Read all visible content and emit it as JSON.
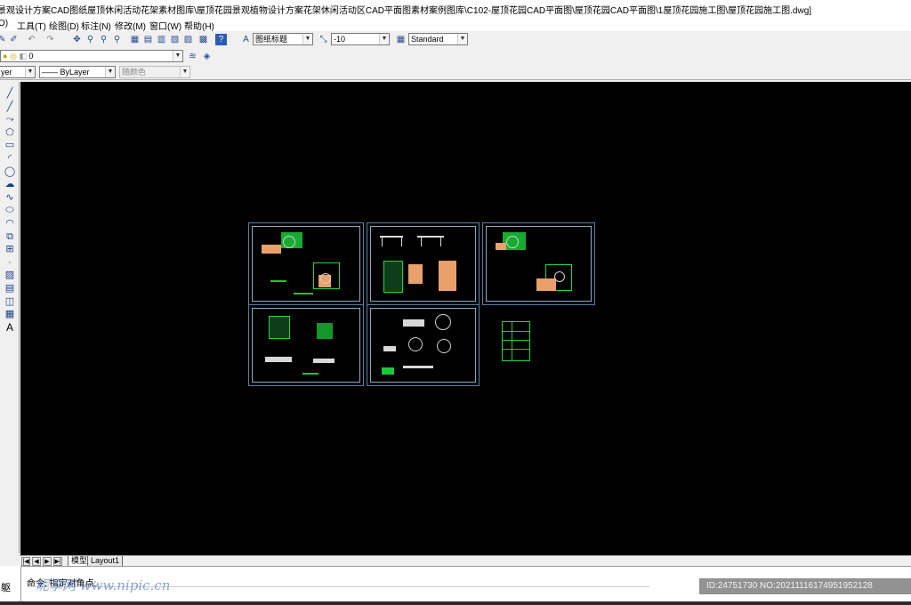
{
  "window": {
    "title": "景观设计方案CAD图纸屋顶休闲活动花架素材图库\\屋顶花园景观植物设计方案花架休闲活动区CAD平面图素材案例图库\\C102-屋顶花园CAD平面图\\屋顶花园CAD平面图\\1屋顶花园施工图\\屋顶花园施工图.dwg]"
  },
  "menu": [
    {
      "label": "O)"
    },
    {
      "label": "工具(T)"
    },
    {
      "label": "绘图(D)"
    },
    {
      "label": "标注(N)"
    },
    {
      "label": "修改(M)"
    },
    {
      "label": "窗口(W)"
    },
    {
      "label": "帮助(H)"
    }
  ],
  "toolbar": {
    "text_style": "图纸标题",
    "dim_value": "-10",
    "table_style": "Standard",
    "layer": "0",
    "layer_partial": "yer",
    "linetype": "ByLayer",
    "color": "随颜色"
  },
  "draw_tools": [
    "line-icon",
    "ray-icon",
    "polyline-icon",
    "polygon-icon",
    "rectangle-icon",
    "arc-icon",
    "circle-icon",
    "cloud-icon",
    "spline-icon",
    "ellipse-icon",
    "ellipse-arc-icon",
    "insert-block-icon",
    "make-block-icon",
    "point-icon",
    "hatch-icon",
    "gradient-icon",
    "region-icon",
    "table-icon",
    "mtext-icon"
  ],
  "tabs": [
    {
      "label": "模型",
      "active": true
    },
    {
      "label": "Layout1",
      "active": false
    }
  ],
  "command": {
    "prompt": "命令: 指定对角点:",
    "side_label": "躯"
  },
  "watermark": {
    "text": "昵享网 www.nipic.cn",
    "image_id": "ID:24751730 NO:20211116174951952128"
  },
  "colors": {
    "canvas": "#000000",
    "frame": "#5d7fa0",
    "linework": "#19c93a",
    "fill": "#e9a06b"
  }
}
